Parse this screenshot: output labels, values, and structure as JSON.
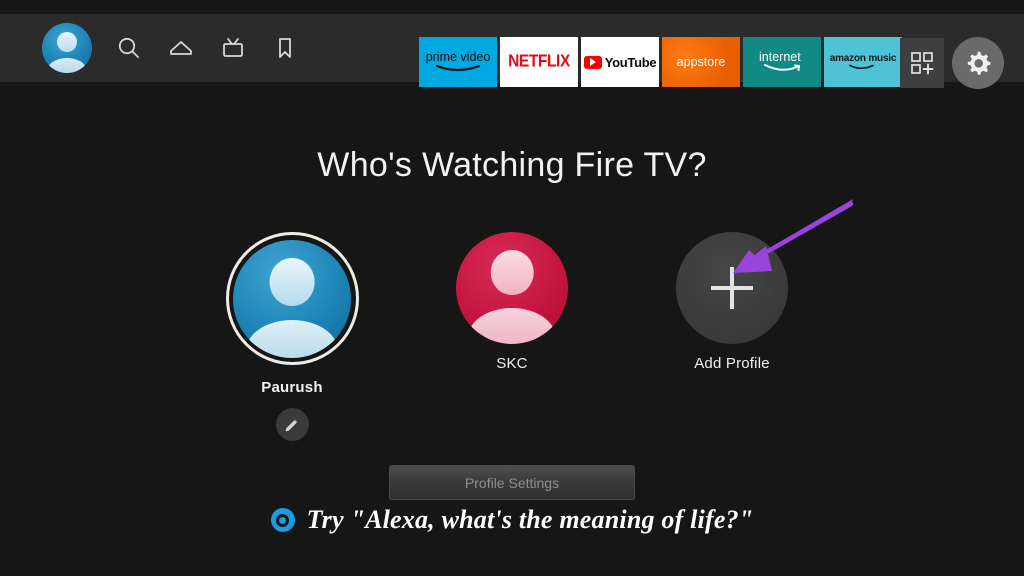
{
  "colors": {
    "background": "#161616",
    "topbar": "#2b2b2b",
    "accent_blue": "#00a8e1",
    "netflix_red": "#e50914",
    "youtube_red": "#ff0000",
    "appstore_orange": "#f26800",
    "internet_teal": "#118a86",
    "music_cyan": "#4fc3d6",
    "arrow_purple": "#9945dd",
    "alexa_blue": "#1e9ade",
    "profile_blue": "#1b82b4",
    "profile_red": "#c4143f"
  },
  "topbar": {
    "profile_avatar_name": "profile-avatar-icon",
    "nav_icons": [
      {
        "name": "search-icon",
        "label": "Search"
      },
      {
        "name": "home-icon",
        "label": "Home"
      },
      {
        "name": "live-tv-icon",
        "label": "Live TV"
      },
      {
        "name": "bookmark-icon",
        "label": "Watchlist"
      }
    ],
    "app_tiles": [
      {
        "name": "app-tile-prime-video",
        "label": "prime video"
      },
      {
        "name": "app-tile-netflix",
        "label": "NETFLIX"
      },
      {
        "name": "app-tile-youtube",
        "label": "YouTube"
      },
      {
        "name": "app-tile-appstore",
        "label": "appstore"
      },
      {
        "name": "app-tile-internet",
        "label": "internet"
      },
      {
        "name": "app-tile-amazon-music",
        "label": "amazon music"
      }
    ],
    "apps_grid_label": "Apps",
    "settings_label": "Settings"
  },
  "main": {
    "heading": "Who's Watching Fire TV?",
    "profiles": [
      {
        "name": "Paurush",
        "type": "user",
        "color": "blue",
        "selected": true,
        "has_edit_button": true
      },
      {
        "name": "SKC",
        "type": "user",
        "color": "red",
        "selected": false,
        "has_edit_button": false
      },
      {
        "name": "Add Profile",
        "type": "add",
        "color": "gray",
        "selected": false,
        "has_edit_button": false
      }
    ],
    "settings_button": "Profile Settings",
    "alexa_hint": "Try \"Alexa, what's the meaning of life?\""
  },
  "annotation": {
    "arrow_name": "annotation-arrow",
    "points_to": "Add Profile"
  }
}
